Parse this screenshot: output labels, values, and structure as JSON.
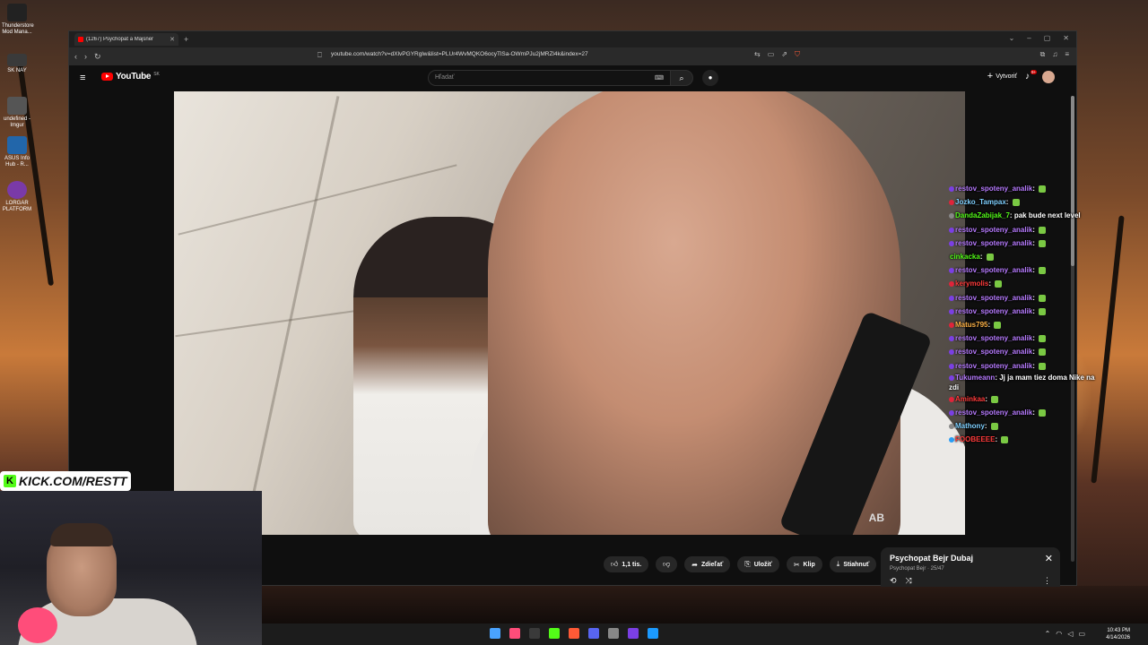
{
  "desktop": {
    "icons": [
      {
        "label": "Thunderstore Mod Mana...",
        "color": "#222222"
      },
      {
        "label": "SK NAY",
        "color": "#3a3a3a"
      },
      {
        "label": "undefined - Imgur",
        "color": "#555555"
      },
      {
        "label": "ASUS Info Hub - R...",
        "color": "#2266aa"
      },
      {
        "label": "LORGAR PLATFORM",
        "color": "#7a3aa8"
      }
    ]
  },
  "browser": {
    "tab_title": "(1267) Psychopat a Majsner",
    "url": "youtube.com/watch?v=dXlvPGYRglw&list=PLUr4WvMQKO6ocyTlSa-OWmPJu2jMRZl4k&index=27"
  },
  "youtube": {
    "logo_text": "YouTube",
    "country_code": "SK",
    "search_placeholder": "Hľadať",
    "create_label": "Vytvoriť",
    "notification_count": "9+"
  },
  "video": {
    "watermark": "AB"
  },
  "chat": {
    "messages": [
      {
        "user": "restov_spoteny_analik",
        "user_color": "#b77bff",
        "badge_color": "#7b3fe4",
        "text": ""
      },
      {
        "user": "Jozko_Tampax",
        "user_color": "#7fd0ff",
        "badge_color": "#e0243a",
        "text": ""
      },
      {
        "user": "DandaZabijak_7",
        "user_color": "#53fc18",
        "badge_color": "#888888",
        "text": "pak bude next level"
      },
      {
        "user": "restov_spoteny_analik",
        "user_color": "#b77bff",
        "badge_color": "#7b3fe4",
        "text": ""
      },
      {
        "user": "restov_spoteny_analik",
        "user_color": "#b77bff",
        "badge_color": "#7b3fe4",
        "text": ""
      },
      {
        "user": "cinkacka",
        "user_color": "#53fc18",
        "badge_color": "",
        "text": ""
      },
      {
        "user": "restov_spoteny_analik",
        "user_color": "#b77bff",
        "badge_color": "#7b3fe4",
        "text": ""
      },
      {
        "user": "kerymolis",
        "user_color": "#ff3b3b",
        "badge_color": "#e0243a",
        "text": ""
      },
      {
        "user": "restov_spoteny_analik",
        "user_color": "#b77bff",
        "badge_color": "#7b3fe4",
        "text": ""
      },
      {
        "user": "restov_spoteny_analik",
        "user_color": "#b77bff",
        "badge_color": "#7b3fe4",
        "text": ""
      },
      {
        "user": "Matus795",
        "user_color": "#ffb347",
        "badge_color": "#e0243a",
        "text": ""
      },
      {
        "user": "restov_spoteny_analik",
        "user_color": "#b77bff",
        "badge_color": "#7b3fe4",
        "text": ""
      },
      {
        "user": "restov_spoteny_analik",
        "user_color": "#b77bff",
        "badge_color": "#7b3fe4",
        "text": ""
      },
      {
        "user": "restov_spoteny_analik",
        "user_color": "#b77bff",
        "badge_color": "#7b3fe4",
        "text": ""
      },
      {
        "user": "Tukumeann",
        "user_color": "#b77bff",
        "badge_color": "#7b3fe4",
        "text": "Jj ja mam tiez doma Nike na zdi"
      },
      {
        "user": "Aminkaa",
        "user_color": "#ff3b3b",
        "badge_color": "#e0243a",
        "text": ""
      },
      {
        "user": "restov_spoteny_analik",
        "user_color": "#b77bff",
        "badge_color": "#7b3fe4",
        "text": ""
      },
      {
        "user": "Mathony",
        "user_color": "#7fd0ff",
        "badge_color": "#888888",
        "text": ""
      },
      {
        "user": "FOOBEEEE",
        "user_color": "#ff3b3b",
        "badge_color": "#2a9df4",
        "text": ""
      }
    ]
  },
  "actions": {
    "like_count": "1,1 tis.",
    "share_label": "Zdieľať",
    "save_label": "Uložiť",
    "clip_label": "Klip",
    "download_label": "Stiahnuť"
  },
  "playlist": {
    "title": "Psychopat Bejr  Dubaj",
    "subtitle": "Psychopat Bejr · 25/47"
  },
  "overlay": {
    "kick_text": "KICK.COM/RESTT"
  },
  "taskbar": {
    "time": "10:43 PM",
    "date": "4/14/2026",
    "icons": [
      "#4aa3ff",
      "#ff4d7a",
      "#3a3a3a",
      "#53fc18",
      "#ff5a36",
      "#5865f2",
      "#888888",
      "#7b3fe4",
      "#1b9aff"
    ]
  }
}
